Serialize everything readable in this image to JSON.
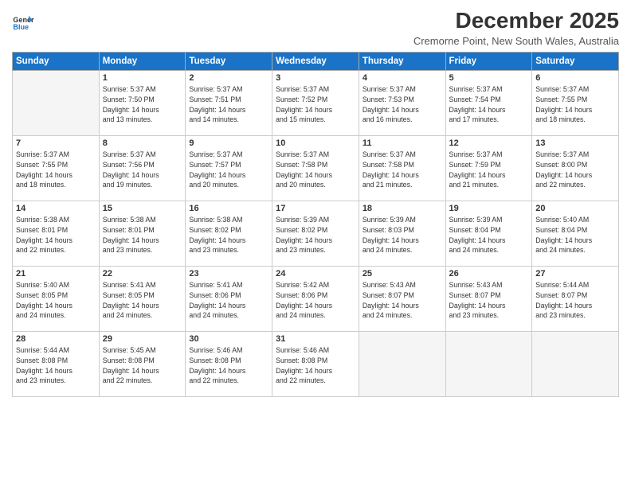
{
  "logo": {
    "line1": "General",
    "line2": "Blue"
  },
  "title": "December 2025",
  "subtitle": "Cremorne Point, New South Wales, Australia",
  "weekdays": [
    "Sunday",
    "Monday",
    "Tuesday",
    "Wednesday",
    "Thursday",
    "Friday",
    "Saturday"
  ],
  "weeks": [
    [
      {
        "day": "",
        "info": ""
      },
      {
        "day": "1",
        "info": "Sunrise: 5:37 AM\nSunset: 7:50 PM\nDaylight: 14 hours\nand 13 minutes."
      },
      {
        "day": "2",
        "info": "Sunrise: 5:37 AM\nSunset: 7:51 PM\nDaylight: 14 hours\nand 14 minutes."
      },
      {
        "day": "3",
        "info": "Sunrise: 5:37 AM\nSunset: 7:52 PM\nDaylight: 14 hours\nand 15 minutes."
      },
      {
        "day": "4",
        "info": "Sunrise: 5:37 AM\nSunset: 7:53 PM\nDaylight: 14 hours\nand 16 minutes."
      },
      {
        "day": "5",
        "info": "Sunrise: 5:37 AM\nSunset: 7:54 PM\nDaylight: 14 hours\nand 17 minutes."
      },
      {
        "day": "6",
        "info": "Sunrise: 5:37 AM\nSunset: 7:55 PM\nDaylight: 14 hours\nand 18 minutes."
      }
    ],
    [
      {
        "day": "7",
        "info": "Sunrise: 5:37 AM\nSunset: 7:55 PM\nDaylight: 14 hours\nand 18 minutes."
      },
      {
        "day": "8",
        "info": "Sunrise: 5:37 AM\nSunset: 7:56 PM\nDaylight: 14 hours\nand 19 minutes."
      },
      {
        "day": "9",
        "info": "Sunrise: 5:37 AM\nSunset: 7:57 PM\nDaylight: 14 hours\nand 20 minutes."
      },
      {
        "day": "10",
        "info": "Sunrise: 5:37 AM\nSunset: 7:58 PM\nDaylight: 14 hours\nand 20 minutes."
      },
      {
        "day": "11",
        "info": "Sunrise: 5:37 AM\nSunset: 7:58 PM\nDaylight: 14 hours\nand 21 minutes."
      },
      {
        "day": "12",
        "info": "Sunrise: 5:37 AM\nSunset: 7:59 PM\nDaylight: 14 hours\nand 21 minutes."
      },
      {
        "day": "13",
        "info": "Sunrise: 5:37 AM\nSunset: 8:00 PM\nDaylight: 14 hours\nand 22 minutes."
      }
    ],
    [
      {
        "day": "14",
        "info": "Sunrise: 5:38 AM\nSunset: 8:01 PM\nDaylight: 14 hours\nand 22 minutes."
      },
      {
        "day": "15",
        "info": "Sunrise: 5:38 AM\nSunset: 8:01 PM\nDaylight: 14 hours\nand 23 minutes."
      },
      {
        "day": "16",
        "info": "Sunrise: 5:38 AM\nSunset: 8:02 PM\nDaylight: 14 hours\nand 23 minutes."
      },
      {
        "day": "17",
        "info": "Sunrise: 5:39 AM\nSunset: 8:02 PM\nDaylight: 14 hours\nand 23 minutes."
      },
      {
        "day": "18",
        "info": "Sunrise: 5:39 AM\nSunset: 8:03 PM\nDaylight: 14 hours\nand 24 minutes."
      },
      {
        "day": "19",
        "info": "Sunrise: 5:39 AM\nSunset: 8:04 PM\nDaylight: 14 hours\nand 24 minutes."
      },
      {
        "day": "20",
        "info": "Sunrise: 5:40 AM\nSunset: 8:04 PM\nDaylight: 14 hours\nand 24 minutes."
      }
    ],
    [
      {
        "day": "21",
        "info": "Sunrise: 5:40 AM\nSunset: 8:05 PM\nDaylight: 14 hours\nand 24 minutes."
      },
      {
        "day": "22",
        "info": "Sunrise: 5:41 AM\nSunset: 8:05 PM\nDaylight: 14 hours\nand 24 minutes."
      },
      {
        "day": "23",
        "info": "Sunrise: 5:41 AM\nSunset: 8:06 PM\nDaylight: 14 hours\nand 24 minutes."
      },
      {
        "day": "24",
        "info": "Sunrise: 5:42 AM\nSunset: 8:06 PM\nDaylight: 14 hours\nand 24 minutes."
      },
      {
        "day": "25",
        "info": "Sunrise: 5:43 AM\nSunset: 8:07 PM\nDaylight: 14 hours\nand 24 minutes."
      },
      {
        "day": "26",
        "info": "Sunrise: 5:43 AM\nSunset: 8:07 PM\nDaylight: 14 hours\nand 23 minutes."
      },
      {
        "day": "27",
        "info": "Sunrise: 5:44 AM\nSunset: 8:07 PM\nDaylight: 14 hours\nand 23 minutes."
      }
    ],
    [
      {
        "day": "28",
        "info": "Sunrise: 5:44 AM\nSunset: 8:08 PM\nDaylight: 14 hours\nand 23 minutes."
      },
      {
        "day": "29",
        "info": "Sunrise: 5:45 AM\nSunset: 8:08 PM\nDaylight: 14 hours\nand 22 minutes."
      },
      {
        "day": "30",
        "info": "Sunrise: 5:46 AM\nSunset: 8:08 PM\nDaylight: 14 hours\nand 22 minutes."
      },
      {
        "day": "31",
        "info": "Sunrise: 5:46 AM\nSunset: 8:08 PM\nDaylight: 14 hours\nand 22 minutes."
      },
      {
        "day": "",
        "info": ""
      },
      {
        "day": "",
        "info": ""
      },
      {
        "day": "",
        "info": ""
      }
    ]
  ]
}
